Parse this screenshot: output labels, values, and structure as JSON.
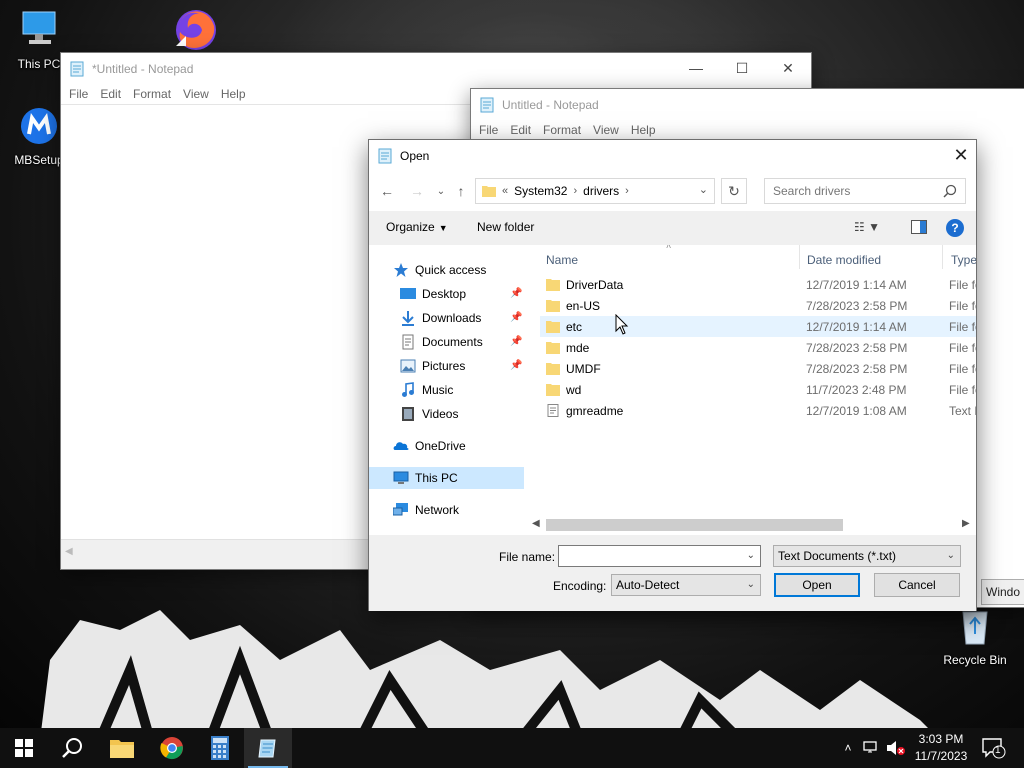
{
  "desktop": {
    "icons": [
      {
        "label": "This PC",
        "icon": "this-pc-icon"
      },
      {
        "label": "MBSetup",
        "icon": "malwarebytes-icon"
      },
      {
        "label": "Recycle Bin",
        "icon": "recycle-bin-icon"
      }
    ]
  },
  "notepad1": {
    "title": "*Untitled - Notepad",
    "menu": [
      "File",
      "Edit",
      "Format",
      "View",
      "Help"
    ],
    "content": ""
  },
  "notepad2": {
    "title": "Untitled - Notepad",
    "menu": [
      "File",
      "Edit",
      "Format",
      "View",
      "Help"
    ],
    "partial_text": "Windo"
  },
  "dialog": {
    "title": "Open",
    "address": {
      "overflow": "«",
      "crumbs": [
        "System32",
        "drivers"
      ]
    },
    "search_placeholder": "Search drivers",
    "toolbar": {
      "organize": "Organize",
      "new_folder": "New folder"
    },
    "nav": [
      {
        "label": "Quick access",
        "icon": "star-icon",
        "pinned": false
      },
      {
        "label": "Desktop",
        "icon": "desktop-icon",
        "pinned": true
      },
      {
        "label": "Downloads",
        "icon": "downloads-icon",
        "pinned": true
      },
      {
        "label": "Documents",
        "icon": "documents-icon",
        "pinned": true
      },
      {
        "label": "Pictures",
        "icon": "pictures-icon",
        "pinned": true
      },
      {
        "label": "Music",
        "icon": "music-icon",
        "pinned": false
      },
      {
        "label": "Videos",
        "icon": "videos-icon",
        "pinned": false
      },
      {
        "label": "OneDrive",
        "icon": "onedrive-icon",
        "pinned": false
      },
      {
        "label": "This PC",
        "icon": "this-pc-icon",
        "pinned": false,
        "selected": true
      },
      {
        "label": "Network",
        "icon": "network-icon",
        "pinned": false
      }
    ],
    "columns": {
      "name": "Name",
      "date": "Date modified",
      "type": "Type"
    },
    "files": [
      {
        "name": "DriverData",
        "date": "12/7/2019 1:14 AM",
        "type": "File fo",
        "kind": "folder"
      },
      {
        "name": "en-US",
        "date": "7/28/2023 2:58 PM",
        "type": "File fo",
        "kind": "folder"
      },
      {
        "name": "etc",
        "date": "12/7/2019 1:14 AM",
        "type": "File fo",
        "kind": "folder",
        "hover": true
      },
      {
        "name": "mde",
        "date": "7/28/2023 2:58 PM",
        "type": "File fo",
        "kind": "folder"
      },
      {
        "name": "UMDF",
        "date": "7/28/2023 2:58 PM",
        "type": "File fo",
        "kind": "folder"
      },
      {
        "name": "wd",
        "date": "11/7/2023 2:48 PM",
        "type": "File fo",
        "kind": "folder"
      },
      {
        "name": "gmreadme",
        "date": "12/7/2019 1:08 AM",
        "type": "Text D",
        "kind": "text"
      }
    ],
    "filename_label": "File name:",
    "filename_value": "",
    "filetype_value": "Text Documents (*.txt)",
    "encoding_label": "Encoding:",
    "encoding_value": "Auto-Detect",
    "open_label": "Open",
    "cancel_label": "Cancel"
  },
  "taskbar": {
    "apps": [
      "windows-start-icon",
      "search-icon",
      "file-explorer-icon",
      "chrome-icon",
      "calculator-icon",
      "notepad-icon"
    ],
    "time": "3:03 PM",
    "date": "11/7/2023",
    "notification_count": "1"
  },
  "colors": {
    "accent": "#0078d7",
    "folder": "#f8d775",
    "selection": "#cce8ff",
    "hover": "#e5f3ff",
    "taskbar": "#101010"
  }
}
